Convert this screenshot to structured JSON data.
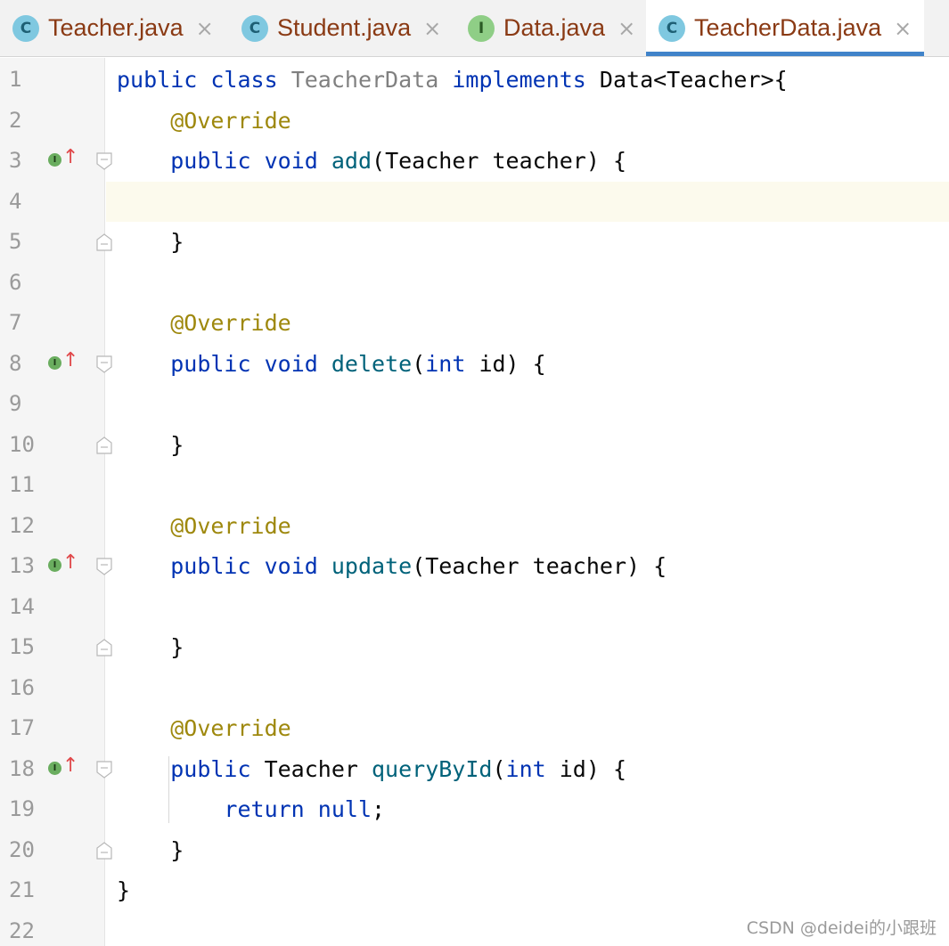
{
  "tabs": [
    {
      "label": "Teacher.java",
      "icon_letter": "C",
      "icon_name": "class-icon",
      "icon_color": "#7fc8e0",
      "icon_text_color": "#1e5f74",
      "active": false
    },
    {
      "label": "Student.java",
      "icon_letter": "C",
      "icon_name": "class-icon",
      "icon_color": "#7fc8e0",
      "icon_text_color": "#1e5f74",
      "active": false
    },
    {
      "label": "Data.java",
      "icon_letter": "I",
      "icon_name": "interface-icon",
      "icon_color": "#8fce86",
      "icon_text_color": "#2a5a25",
      "active": false
    },
    {
      "label": "TeacherData.java",
      "icon_letter": "C",
      "icon_name": "class-icon",
      "icon_color": "#7fc8e0",
      "icon_text_color": "#1e5f74",
      "active": true
    }
  ],
  "close_glyph": "×",
  "current_line": 4,
  "gutter_markers": {
    "implements_letter": "I",
    "arrow_glyph": "↑"
  },
  "lines": [
    {
      "n": "1",
      "tokens": [
        [
          "kw",
          "public"
        ],
        [
          "plain",
          " "
        ],
        [
          "kw",
          "class"
        ],
        [
          "plain",
          " "
        ],
        [
          "cls-decl",
          "TeacherData"
        ],
        [
          "plain",
          " "
        ],
        [
          "kw",
          "implements"
        ],
        [
          "plain",
          " Data<Teacher>{"
        ]
      ]
    },
    {
      "n": "2",
      "tokens": [
        [
          "plain",
          "    "
        ],
        [
          "ann",
          "@Override"
        ]
      ]
    },
    {
      "n": "3",
      "impl": true,
      "fold": "open",
      "tokens": [
        [
          "plain",
          "    "
        ],
        [
          "kw",
          "public"
        ],
        [
          "plain",
          " "
        ],
        [
          "kw",
          "void"
        ],
        [
          "plain",
          " "
        ],
        [
          "method",
          "add"
        ],
        [
          "plain",
          "(Teacher teacher) {"
        ]
      ]
    },
    {
      "n": "4",
      "tokens": []
    },
    {
      "n": "5",
      "fold": "close",
      "tokens": [
        [
          "plain",
          "    }"
        ]
      ]
    },
    {
      "n": "6",
      "tokens": []
    },
    {
      "n": "7",
      "tokens": [
        [
          "plain",
          "    "
        ],
        [
          "ann",
          "@Override"
        ]
      ]
    },
    {
      "n": "8",
      "impl": true,
      "fold": "open",
      "tokens": [
        [
          "plain",
          "    "
        ],
        [
          "kw",
          "public"
        ],
        [
          "plain",
          " "
        ],
        [
          "kw",
          "void"
        ],
        [
          "plain",
          " "
        ],
        [
          "method",
          "delete"
        ],
        [
          "plain",
          "("
        ],
        [
          "kw",
          "int"
        ],
        [
          "plain",
          " id) {"
        ]
      ]
    },
    {
      "n": "9",
      "tokens": []
    },
    {
      "n": "10",
      "fold": "close",
      "tokens": [
        [
          "plain",
          "    }"
        ]
      ]
    },
    {
      "n": "11",
      "tokens": []
    },
    {
      "n": "12",
      "tokens": [
        [
          "plain",
          "    "
        ],
        [
          "ann",
          "@Override"
        ]
      ]
    },
    {
      "n": "13",
      "impl": true,
      "fold": "open",
      "tokens": [
        [
          "plain",
          "    "
        ],
        [
          "kw",
          "public"
        ],
        [
          "plain",
          " "
        ],
        [
          "kw",
          "void"
        ],
        [
          "plain",
          " "
        ],
        [
          "method",
          "update"
        ],
        [
          "plain",
          "(Teacher teacher) {"
        ]
      ]
    },
    {
      "n": "14",
      "tokens": []
    },
    {
      "n": "15",
      "fold": "close",
      "tokens": [
        [
          "plain",
          "    }"
        ]
      ]
    },
    {
      "n": "16",
      "tokens": []
    },
    {
      "n": "17",
      "tokens": [
        [
          "plain",
          "    "
        ],
        [
          "ann",
          "@Override"
        ]
      ]
    },
    {
      "n": "18",
      "impl": true,
      "fold": "open",
      "tokens": [
        [
          "plain",
          "    "
        ],
        [
          "kw",
          "public"
        ],
        [
          "plain",
          " Teacher "
        ],
        [
          "method",
          "queryById"
        ],
        [
          "plain",
          "("
        ],
        [
          "kw",
          "int"
        ],
        [
          "plain",
          " id) {"
        ]
      ]
    },
    {
      "n": "19",
      "tokens": [
        [
          "plain",
          "        "
        ],
        [
          "kw",
          "return"
        ],
        [
          "plain",
          " "
        ],
        [
          "kw",
          "null"
        ],
        [
          "plain",
          ";"
        ]
      ]
    },
    {
      "n": "20",
      "fold": "close",
      "tokens": [
        [
          "plain",
          "    }"
        ]
      ]
    },
    {
      "n": "21",
      "tokens": [
        [
          "plain",
          "}"
        ]
      ]
    },
    {
      "n": "22",
      "tokens": []
    }
  ],
  "watermark": "CSDN @deidei的小跟班"
}
